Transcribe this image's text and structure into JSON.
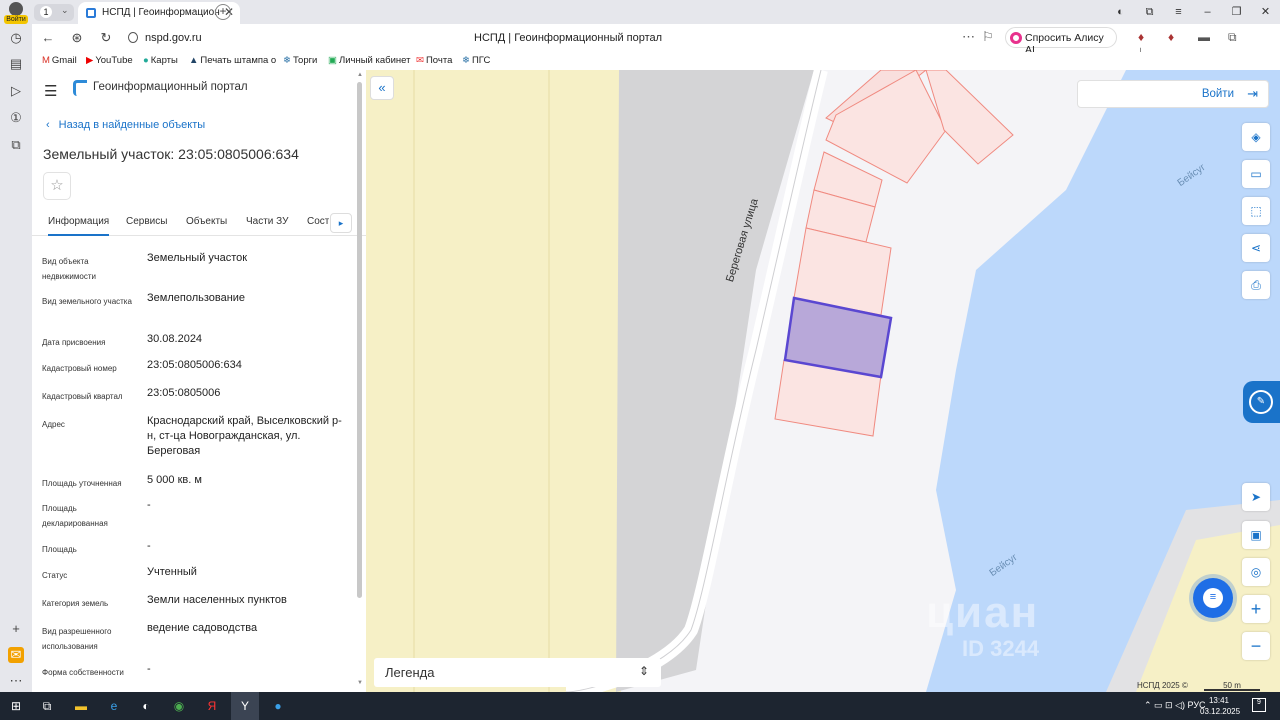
{
  "browser": {
    "profile_label": "Войти",
    "tab_count": "1",
    "tab_title": "НСПД | Геоинформационн",
    "url": "nspd.gov.ru",
    "page_title": "НСПД | Геоинформационный портал",
    "alice_button": "Спросить Алису AI",
    "bookmarks": [
      "Gmail",
      "YouTube",
      "Карты",
      "Печать штампа о",
      "Торги",
      "Личный кабинет",
      "Почта",
      "ПГС"
    ]
  },
  "panel": {
    "portal_name": "Геоинформационный портал",
    "back_link": "Назад в найденные объекты",
    "title": "Земельный участок: 23:05:0805006:634",
    "tabs": [
      "Информация",
      "Сервисы",
      "Объекты",
      "Части ЗУ",
      "Соста"
    ],
    "properties": [
      {
        "key": "Вид объекта недвижимости",
        "value": "Земельный участок"
      },
      {
        "key": "Вид земельного участка",
        "value": "Землепользование"
      },
      {
        "key": "Дата присвоения",
        "value": "30.08.2024"
      },
      {
        "key": "Кадастровый номер",
        "value": "23:05:0805006:634"
      },
      {
        "key": "Кадастровый квартал",
        "value": "23:05:0805006"
      },
      {
        "key": "Адрес",
        "value": "Краснодарский край, Выселковский р-н, ст-ца Новогражданская, ул. Береговая"
      },
      {
        "key": "Площадь уточненная",
        "value": "5 000 кв. м"
      },
      {
        "key": "Площадь декларированная",
        "value": "-"
      },
      {
        "key": "Площадь",
        "value": "-"
      },
      {
        "key": "Статус",
        "value": "Учтенный"
      },
      {
        "key": "Категория земель",
        "value": "Земли населенных пунктов"
      },
      {
        "key": "Вид разрешенного использования",
        "value": "ведение садоводства"
      },
      {
        "key": "Форма собственности",
        "value": "-"
      }
    ]
  },
  "map": {
    "login_label": "Войти",
    "street_label": "Береговая улица",
    "water_label": "Бейсуг",
    "legend_label": "Легенда",
    "copyright": "НСПД 2025 ©",
    "scale": "50 m",
    "watermark": "циан",
    "watermark_id": "ID 3244",
    "selected_color": "#5a47d1",
    "parcel_color": "#f08a80",
    "water_color": "#bcd8fb"
  },
  "taskbar": {
    "language": "РУС",
    "time": "13:41",
    "date": "03.12.2025",
    "notifications": "9"
  }
}
